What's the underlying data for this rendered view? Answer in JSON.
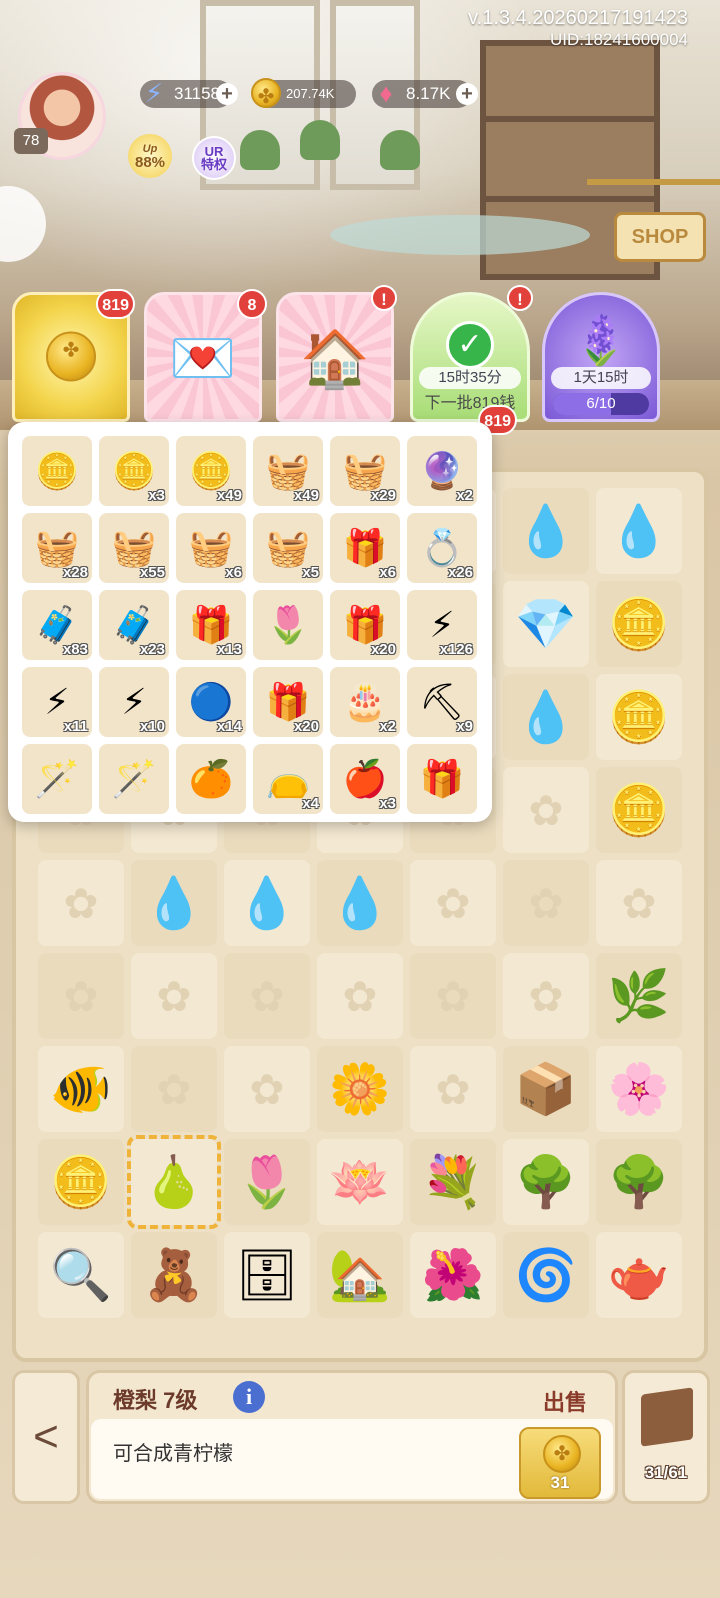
{
  "header": {
    "version": "v.1.3.4.20260217191423",
    "uid": "UID:18241600004",
    "level": "78",
    "energy": "31158",
    "coins": "207.74K",
    "gems": "8.17K",
    "up_bonus": "88%",
    "up_tag": "Up",
    "ur_label": "UR",
    "ur_sub": "特权",
    "shop_label": "SHOP"
  },
  "tabs": {
    "coins_badge": "819",
    "mail_badge": "8",
    "house_badge": "!",
    "timer_badge": "!",
    "timer_time": "15时35分",
    "timer_sub": "下一批819钱",
    "timer_count_badge": "819",
    "lav_time": "1天15时",
    "lav_progress_text": "6/10",
    "lav_progress": 0.6
  },
  "inventory": [
    {
      "icon": "coins-small-icon",
      "glyph": "🪙",
      "qty": ""
    },
    {
      "icon": "coins-medium-icon",
      "glyph": "🪙",
      "qty": "x3"
    },
    {
      "icon": "coins-pile-icon",
      "glyph": "🪙",
      "qty": "x49"
    },
    {
      "icon": "gift-basket-icon",
      "glyph": "🧺",
      "qty": "x49"
    },
    {
      "icon": "flower-basket-icon",
      "glyph": "🧺",
      "qty": "x29"
    },
    {
      "icon": "glass-dome-flower-icon",
      "glyph": "🔮",
      "qty": "x2"
    },
    {
      "icon": "toy-basket-icon",
      "glyph": "🧺",
      "qty": "x28"
    },
    {
      "icon": "crystal-basket-icon",
      "glyph": "🧺",
      "qty": "x55"
    },
    {
      "icon": "green-basket-icon",
      "glyph": "🧺",
      "qty": "x6"
    },
    {
      "icon": "card-basket-icon",
      "glyph": "🧺",
      "qty": "x5"
    },
    {
      "icon": "gift-stack-icon",
      "glyph": "🎁",
      "qty": "x6"
    },
    {
      "icon": "jewel-box-icon",
      "glyph": "💍",
      "qty": "x26"
    },
    {
      "icon": "blue-suitcase-icon",
      "glyph": "🧳",
      "qty": "x83"
    },
    {
      "icon": "brown-suitcase-icon",
      "glyph": "🧳",
      "qty": "x23"
    },
    {
      "icon": "clover-gift-icon",
      "glyph": "🎁",
      "qty": "x13"
    },
    {
      "icon": "calla-lily-icon",
      "glyph": "🌷",
      "qty": ""
    },
    {
      "icon": "purple-gift-icon",
      "glyph": "🎁",
      "qty": "x20"
    },
    {
      "icon": "lightning-icon",
      "glyph": "⚡",
      "qty": "x126"
    },
    {
      "icon": "lightning-double-icon",
      "glyph": "⚡",
      "qty": "x11"
    },
    {
      "icon": "lightning-triple-icon",
      "glyph": "⚡",
      "qty": "x10"
    },
    {
      "icon": "lightning-orb-icon",
      "glyph": "🔵",
      "qty": "x14"
    },
    {
      "icon": "white-gift-box-icon",
      "glyph": "🎁",
      "qty": "x20"
    },
    {
      "icon": "cake-icon",
      "glyph": "🎂",
      "qty": "x2"
    },
    {
      "icon": "pickaxe-icon",
      "glyph": "⛏",
      "qty": "x9"
    },
    {
      "icon": "flower-scythe-icon",
      "glyph": "🪄",
      "qty": ""
    },
    {
      "icon": "rose-scythe-icon",
      "glyph": "🪄",
      "qty": ""
    },
    {
      "icon": "tangerines-icon",
      "glyph": "🍊",
      "qty": ""
    },
    {
      "icon": "seed-bag-icon",
      "glyph": "👝",
      "qty": "x4"
    },
    {
      "icon": "pomegranate-icon",
      "glyph": "🍎",
      "qty": "x3"
    },
    {
      "icon": "golden-gift-icon",
      "glyph": "🎁",
      "qty": ""
    }
  ],
  "board": [
    {
      "icon": "",
      "glyph": ""
    },
    {
      "icon": "",
      "glyph": ""
    },
    {
      "icon": "",
      "glyph": ""
    },
    {
      "icon": "",
      "glyph": ""
    },
    {
      "icon": "",
      "glyph": ""
    },
    {
      "icon": "water-drop-purple-icon",
      "glyph": "💧"
    },
    {
      "icon": "water-drop-purple-icon",
      "glyph": "💧"
    },
    {
      "icon": "",
      "glyph": ""
    },
    {
      "icon": "",
      "glyph": ""
    },
    {
      "icon": "",
      "glyph": ""
    },
    {
      "icon": "",
      "glyph": ""
    },
    {
      "icon": "bubble-icon",
      "glyph": "🫧"
    },
    {
      "icon": "rainbow-gem-icon",
      "glyph": "💎"
    },
    {
      "icon": "coin-icon",
      "glyph": "🪙"
    },
    {
      "icon": "",
      "glyph": ""
    },
    {
      "icon": "",
      "glyph": ""
    },
    {
      "icon": "",
      "glyph": ""
    },
    {
      "icon": "",
      "glyph": ""
    },
    {
      "icon": "",
      "glyph": ""
    },
    {
      "icon": "water-drop-bubble-icon",
      "glyph": "💧"
    },
    {
      "icon": "coins-pair-icon",
      "glyph": "🪙"
    },
    {
      "icon": "",
      "glyph": ""
    },
    {
      "icon": "",
      "glyph": ""
    },
    {
      "icon": "",
      "glyph": ""
    },
    {
      "icon": "",
      "glyph": ""
    },
    {
      "icon": "",
      "glyph": ""
    },
    {
      "icon": "",
      "glyph": ""
    },
    {
      "icon": "coin-icon",
      "glyph": "🪙"
    },
    {
      "icon": "",
      "glyph": ""
    },
    {
      "icon": "water-drop-blue-icon",
      "glyph": "💧"
    },
    {
      "icon": "water-drop-green-icon",
      "glyph": "💧"
    },
    {
      "icon": "water-drop-green-icon",
      "glyph": "💧"
    },
    {
      "icon": "",
      "glyph": ""
    },
    {
      "icon": "",
      "glyph": ""
    },
    {
      "icon": "",
      "glyph": ""
    },
    {
      "icon": "",
      "glyph": ""
    },
    {
      "icon": "",
      "glyph": ""
    },
    {
      "icon": "",
      "glyph": ""
    },
    {
      "icon": "",
      "glyph": ""
    },
    {
      "icon": "",
      "glyph": ""
    },
    {
      "icon": "",
      "glyph": ""
    },
    {
      "icon": "vine-dome-icon",
      "glyph": "🌿"
    },
    {
      "icon": "goldfish-icon",
      "glyph": "🐠"
    },
    {
      "icon": "",
      "glyph": ""
    },
    {
      "icon": "",
      "glyph": ""
    },
    {
      "icon": "yellow-flowers-icon",
      "glyph": "🌼"
    },
    {
      "icon": "",
      "glyph": ""
    },
    {
      "icon": "seed-crate-icon",
      "glyph": "📦"
    },
    {
      "icon": "magnolia-icon",
      "glyph": "🌸"
    },
    {
      "icon": "coins-stack-icon",
      "glyph": "🪙"
    },
    {
      "icon": "pear-icon",
      "glyph": "🍐"
    },
    {
      "icon": "calla-lily-icon",
      "glyph": "🌷"
    },
    {
      "icon": "water-lily-icon",
      "glyph": "🪷"
    },
    {
      "icon": "lily-bouquet-icon",
      "glyph": "💐"
    },
    {
      "icon": "tree-dome-red-icon",
      "glyph": "🌳"
    },
    {
      "icon": "tree-dome-blue-icon",
      "glyph": "🌳"
    },
    {
      "icon": "magnifier-icon",
      "glyph": "🔍"
    },
    {
      "icon": "bear-tray-icon",
      "glyph": "🧸"
    },
    {
      "icon": "cabinet-icon",
      "glyph": "🗄"
    },
    {
      "icon": "greenhouse-icon",
      "glyph": "🏡"
    },
    {
      "icon": "garden-trellis-icon",
      "glyph": "🌺"
    },
    {
      "icon": "galaxy-orb-icon",
      "glyph": "🌀"
    },
    {
      "icon": "teapot-icon",
      "glyph": "🫖"
    }
  ],
  "bottom": {
    "item_title": "橙梨 7级",
    "sell_label": "出售",
    "description": "可合成青柠檬",
    "sell_price": "31",
    "storage": "31/61",
    "back_glyph": "<",
    "info_glyph": "i"
  }
}
